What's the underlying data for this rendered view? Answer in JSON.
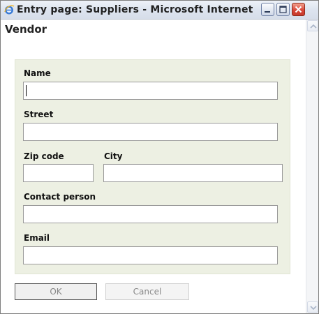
{
  "window": {
    "title": "Entry page: Suppliers - Microsoft Internet ...",
    "icon": "ie-icon"
  },
  "form": {
    "heading": "Vendor",
    "fields": {
      "name": {
        "label": "Name",
        "value": ""
      },
      "street": {
        "label": "Street",
        "value": ""
      },
      "zip": {
        "label": "Zip code",
        "value": ""
      },
      "city": {
        "label": "City",
        "value": ""
      },
      "contact": {
        "label": "Contact person",
        "value": ""
      },
      "email": {
        "label": "Email",
        "value": ""
      }
    }
  },
  "buttons": {
    "ok": "OK",
    "cancel": "Cancel"
  },
  "colors": {
    "panel_bg": "#edf0e3",
    "close_button": "#d9483a"
  }
}
